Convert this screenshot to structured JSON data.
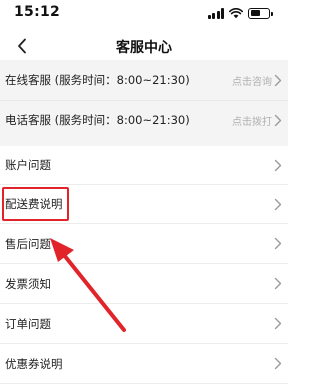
{
  "status_bar": {
    "time": "15:12"
  },
  "nav": {
    "title": "客服中心"
  },
  "contact_rows": [
    {
      "label": "在线客服 (服务时间：8:00~21:30)",
      "action": "点击咨询"
    },
    {
      "label": "电话客服 (服务时间：8:00~21:30)",
      "action": "点击拨打"
    }
  ],
  "faq_items": [
    {
      "label": "账户问题"
    },
    {
      "label": "配送费说明"
    },
    {
      "label": "售后问题"
    },
    {
      "label": "发票须知"
    },
    {
      "label": "订单问题"
    },
    {
      "label": "优惠券说明"
    }
  ],
  "colors": {
    "annotation": "#e0242a",
    "chevron": "#9a9a9a",
    "section_bg": "#f4f4f4"
  }
}
